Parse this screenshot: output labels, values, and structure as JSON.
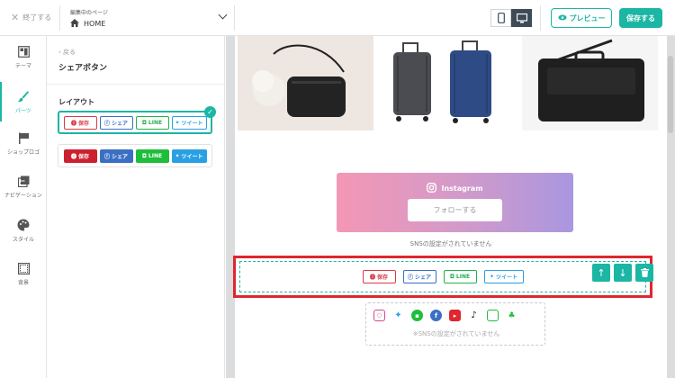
{
  "topbar": {
    "exit_label": "終了する",
    "page_small": "編集中のページ",
    "page_name": "HOME",
    "preview_label": "プレビュー",
    "save_label": "保存する"
  },
  "rail": {
    "items": [
      {
        "label": "テーマ",
        "icon": "theme-icon"
      },
      {
        "label": "パーツ",
        "icon": "brush-icon"
      },
      {
        "label": "ショップロゴ",
        "icon": "flag-icon"
      },
      {
        "label": "ナビゲーション",
        "icon": "navigation-icon"
      },
      {
        "label": "スタイル",
        "icon": "palette-icon"
      },
      {
        "label": "背景",
        "icon": "background-icon"
      }
    ]
  },
  "panel": {
    "back_label": "戻る",
    "title": "シェアボタン",
    "layout_label": "レイアウト"
  },
  "buttons": {
    "save": "保存",
    "share": "シェア",
    "line": "LINE",
    "tweet": "ツイート"
  },
  "preview": {
    "instagram_label": "Instagram",
    "follow_label": "フォローする",
    "sns_not_set": "SNSの設定がされていません",
    "sns_not_set_note": "※SNSの設定がされていません"
  },
  "colors": {
    "accent": "#1bb6a4",
    "highlight": "#e0262f"
  }
}
